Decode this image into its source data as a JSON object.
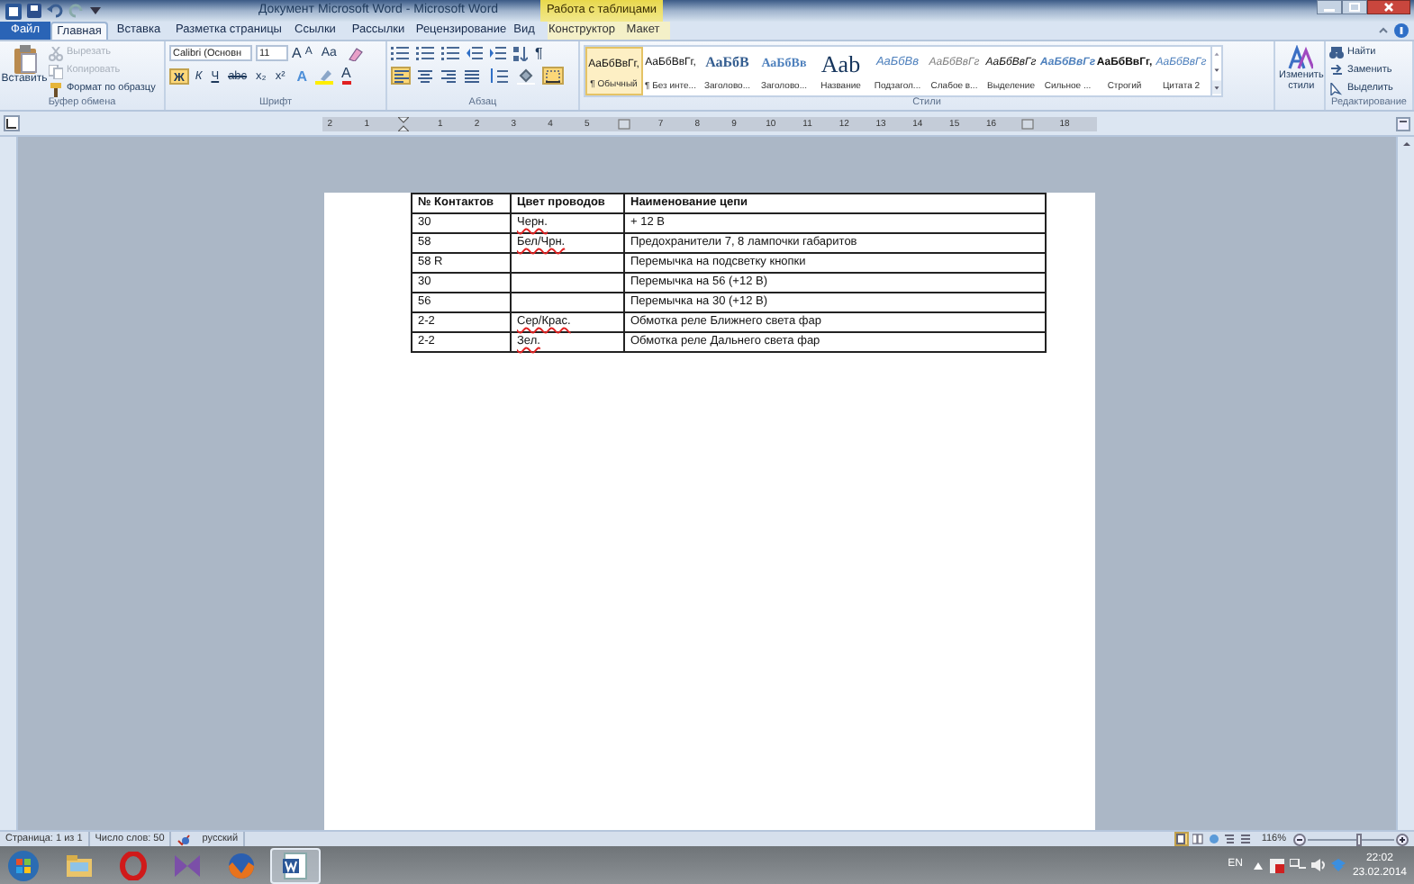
{
  "window": {
    "title": "Документ Microsoft Word - Microsoft Word",
    "context_header": "Работа с таблицами"
  },
  "tabs": [
    {
      "label": "Файл",
      "kind": "file",
      "selected": false
    },
    {
      "label": "Главная",
      "kind": "normal",
      "selected": true
    },
    {
      "label": "Вставка",
      "kind": "normal",
      "selected": false
    },
    {
      "label": "Разметка страницы",
      "kind": "normal",
      "selected": false
    },
    {
      "label": "Ссылки",
      "kind": "normal",
      "selected": false
    },
    {
      "label": "Рассылки",
      "kind": "normal",
      "selected": false
    },
    {
      "label": "Рецензирование",
      "kind": "normal",
      "selected": false
    },
    {
      "label": "Вид",
      "kind": "normal",
      "selected": false
    },
    {
      "label": "Конструктор",
      "kind": "context",
      "selected": false
    },
    {
      "label": "Макет",
      "kind": "context",
      "selected": false
    }
  ],
  "clipboard": {
    "paste": "Вставить",
    "group_label": "Буфер обмена",
    "commands": [
      {
        "label": "Вырезать",
        "kind": "cut",
        "disabled": true
      },
      {
        "label": "Копировать",
        "kind": "copy",
        "disabled": true
      },
      {
        "label": "Формат по образцу",
        "kind": "painter",
        "disabled": false
      }
    ]
  },
  "font": {
    "name": "Calibri (Основн",
    "size": "11",
    "grow": "A",
    "shrink": "A",
    "case": "Aa",
    "group_label": "Шрифт",
    "buttons": [
      {
        "label": "Ж",
        "kind": "bold",
        "selected": true
      },
      {
        "label": "К",
        "kind": "italic",
        "selected": false
      },
      {
        "label": "Ч",
        "kind": "underline",
        "selected": false
      },
      {
        "label": "abc",
        "kind": "strike",
        "selected": false
      },
      {
        "label": "x₂",
        "kind": "sub",
        "selected": false
      },
      {
        "label": "x²",
        "kind": "sup",
        "selected": false
      }
    ],
    "text_effects": "A",
    "font_color": "A"
  },
  "paragraph": {
    "group_label": "Абзац",
    "pilcrow": "¶",
    "alignment": [
      {
        "kind": "left",
        "selected": true
      },
      {
        "kind": "center",
        "selected": false
      },
      {
        "kind": "right",
        "selected": false
      },
      {
        "kind": "justify",
        "selected": false
      }
    ],
    "borders_selected": true
  },
  "styles": {
    "group_label": "Стили",
    "items": [
      {
        "preview": "АаБбВвГг,",
        "label": "¶ Обычный",
        "kind": "normal",
        "selected": true
      },
      {
        "preview": "АаБбВвГг,",
        "label": "¶ Без инте...",
        "kind": "normal",
        "selected": false
      },
      {
        "preview": "АаБбВ",
        "label": "Заголово...",
        "kind": "heading1",
        "selected": false
      },
      {
        "preview": "АаБбВв",
        "label": "Заголово...",
        "kind": "heading2",
        "selected": false
      },
      {
        "preview": "Aab",
        "label": "Название",
        "kind": "title",
        "selected": false
      },
      {
        "preview": "АаБбВв",
        "label": "Подзагол...",
        "kind": "subtitle",
        "selected": false
      },
      {
        "preview": "АаБбВвГг",
        "label": "Слабое в...",
        "kind": "subtle",
        "selected": false
      },
      {
        "preview": "АаБбВвГг",
        "label": "Выделение",
        "kind": "emphasis",
        "selected": false
      },
      {
        "preview": "АаБбВвГг",
        "label": "Сильное ...",
        "kind": "intense",
        "selected": false
      },
      {
        "preview": "АаБбВвГг,",
        "label": "Строгий",
        "kind": "strong",
        "selected": false
      },
      {
        "preview": "АаБбВвГг",
        "label": "Цитата 2",
        "kind": "quote",
        "selected": false
      }
    ],
    "change_styles": "Изменить стили"
  },
  "editing": {
    "group_label": "Редактирование",
    "commands": [
      {
        "label": "Найти",
        "kind": "find"
      },
      {
        "label": "Заменить",
        "kind": "replace"
      },
      {
        "label": "Выделить",
        "kind": "select"
      }
    ]
  },
  "ruler": [
    {
      "kind": "number",
      "label": "2"
    },
    {
      "kind": "number",
      "label": "1"
    },
    {
      "kind": "margin"
    },
    {
      "kind": "number",
      "label": "1"
    },
    {
      "kind": "number",
      "label": "2"
    },
    {
      "kind": "number",
      "label": "3"
    },
    {
      "kind": "number",
      "label": "4"
    },
    {
      "kind": "number",
      "label": "5"
    },
    {
      "kind": "marker"
    },
    {
      "kind": "number",
      "label": "7"
    },
    {
      "kind": "number",
      "label": "8"
    },
    {
      "kind": "number",
      "label": "9"
    },
    {
      "kind": "number",
      "label": "10"
    },
    {
      "kind": "number",
      "label": "11"
    },
    {
      "kind": "number",
      "label": "12"
    },
    {
      "kind": "number",
      "label": "13"
    },
    {
      "kind": "number",
      "label": "14"
    },
    {
      "kind": "number",
      "label": "15"
    },
    {
      "kind": "number",
      "label": "16"
    },
    {
      "kind": "marker"
    },
    {
      "kind": "number",
      "label": "18"
    }
  ],
  "table": {
    "columns": [
      "№ Контактов",
      "Цвет проводов",
      "Наименование цепи"
    ],
    "rows": [
      {
        "contacts": "30",
        "wire": "Черн.",
        "wire_misspelled": true,
        "circuit": "+ 12 В"
      },
      {
        "contacts": "58",
        "wire": "Бел/Чрн.",
        "wire_misspelled": true,
        "circuit": "Предохранители 7, 8 лампочки габаритов"
      },
      {
        "contacts": "58 R",
        "circuit": "Перемычка на подсветку кнопки"
      },
      {
        "contacts": "30",
        "circuit": "Перемычка на 56 (+12 В)"
      },
      {
        "contacts": "56",
        "circuit": "Перемычка на 30 (+12 В)"
      },
      {
        "contacts": "2-2",
        "wire": "Сер/Крас.",
        "wire_misspelled": true,
        "circuit": "Обмотка реле Ближнего света фар"
      },
      {
        "contacts": "2-2",
        "wire": "Зел.",
        "wire_misspelled": true,
        "circuit": "Обмотка реле Дальнего света фар"
      }
    ]
  },
  "status_bar": {
    "page": "Страница: 1 из 1",
    "words": "Число слов: 50",
    "language": "русский",
    "zoom": "116%",
    "zoom_slider": {
      "level": 0.6
    },
    "views": [
      {
        "kind": "print",
        "selected": true
      },
      {
        "kind": "read",
        "selected": false
      },
      {
        "kind": "web",
        "selected": false
      },
      {
        "kind": "outline",
        "selected": false
      },
      {
        "kind": "draft",
        "selected": false
      }
    ]
  },
  "taskbar": {
    "apps": [
      {
        "kind": "explorer",
        "selected": false
      },
      {
        "kind": "opera",
        "selected": false
      },
      {
        "kind": "studio",
        "selected": false
      },
      {
        "kind": "firefox",
        "selected": false
      },
      {
        "kind": "word",
        "selected": true
      }
    ],
    "input_language": "EN",
    "time": "22:02",
    "date": "23.02.2014"
  }
}
